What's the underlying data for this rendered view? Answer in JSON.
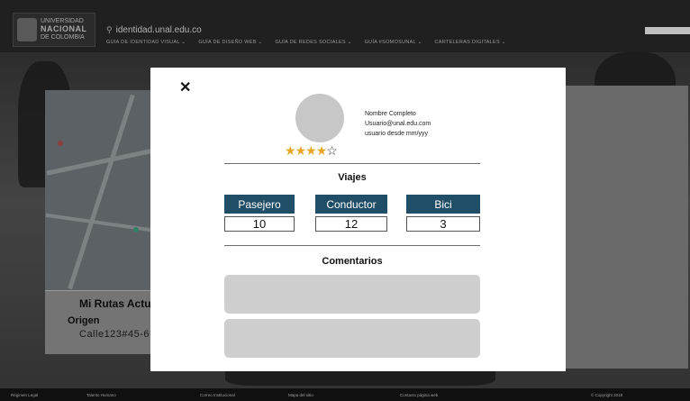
{
  "header": {
    "logo_line1": "UNIVERSIDAD",
    "logo_line2": "NACIONAL",
    "logo_line3": "DE COLOMBIA",
    "domain": "identidad.unal.edu.co",
    "nav": [
      "GUÍA DE IDENTIDAD VISUAL ⌄",
      "GUÍA DE DISEÑO WEB ⌄",
      "GUÍA DE REDES SOCIALES ⌄",
      "GUÍA #SOMOSUNAL ⌄",
      "CARTELERAS DIGITALES ⌄"
    ]
  },
  "route_card": {
    "title": "Mi Rutas Actu",
    "origin_label": "Origen",
    "address": "Calle123#45-6"
  },
  "modal": {
    "close_glyph": "✕",
    "user": {
      "name": "Nombre Completo",
      "email": "Usuario@unal.edu.com",
      "since": "usuario desde mm/yyy"
    },
    "rating": {
      "filled": 4,
      "total": 5
    },
    "trips_title": "Viajes",
    "trips": [
      {
        "label": "Pasejero",
        "value": "10"
      },
      {
        "label": "Conductor",
        "value": "12"
      },
      {
        "label": "Bici",
        "value": "3"
      }
    ],
    "comments_title": "Comentarios",
    "comments_count": 2
  },
  "footer": [
    "Régimen Legal",
    "Talento Humano",
    "Correo Institucional",
    "Mapa del sitio",
    "Contacto página web",
    "© Copyright 2018"
  ],
  "colors": {
    "accent": "#1f4e66",
    "star": "#e8a623"
  }
}
